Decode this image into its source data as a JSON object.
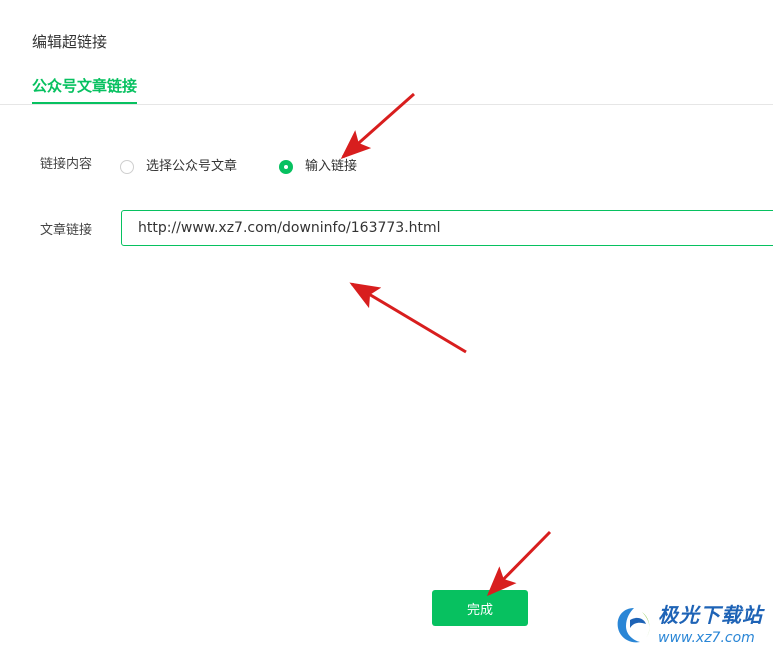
{
  "dialog": {
    "title": "编辑超链接"
  },
  "tabs": [
    {
      "label": "公众号文章链接",
      "active": true
    }
  ],
  "form": {
    "content_label": "链接内容",
    "options": [
      {
        "label": "选择公众号文章",
        "checked": false
      },
      {
        "label": "输入链接",
        "checked": true
      }
    ],
    "link_label": "文章链接",
    "link_value": "http://www.xz7.com/downinfo/163773.html"
  },
  "actions": {
    "done_label": "完成"
  },
  "watermark": {
    "title": "极光下载站",
    "url": "www.xz7.com"
  },
  "colors": {
    "accent": "#07c160",
    "annotation_arrow": "#d81e1e"
  }
}
